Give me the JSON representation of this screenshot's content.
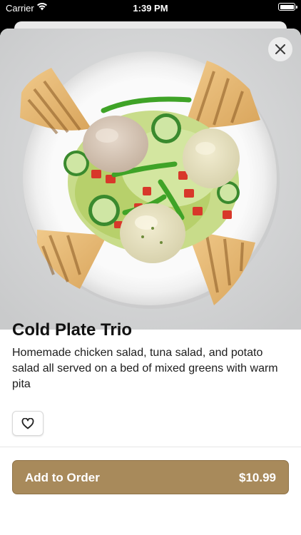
{
  "status_bar": {
    "carrier": "Carrier",
    "time": "1:39 PM",
    "wifi_icon": "wifi-icon",
    "battery_icon": "battery-icon"
  },
  "item": {
    "image_alt_icon": "food-photo",
    "title": "Cold Plate Trio",
    "description": "Homemade chicken salad, tuna salad, and potato salad all served on a bed of mixed greens with warm pita",
    "favorite_icon": "heart-icon"
  },
  "close_icon": "close-icon",
  "footer": {
    "add_label": "Add to Order",
    "price": "$10.99"
  },
  "colors": {
    "accent": "#a88a5b",
    "background": "#ffffff"
  }
}
